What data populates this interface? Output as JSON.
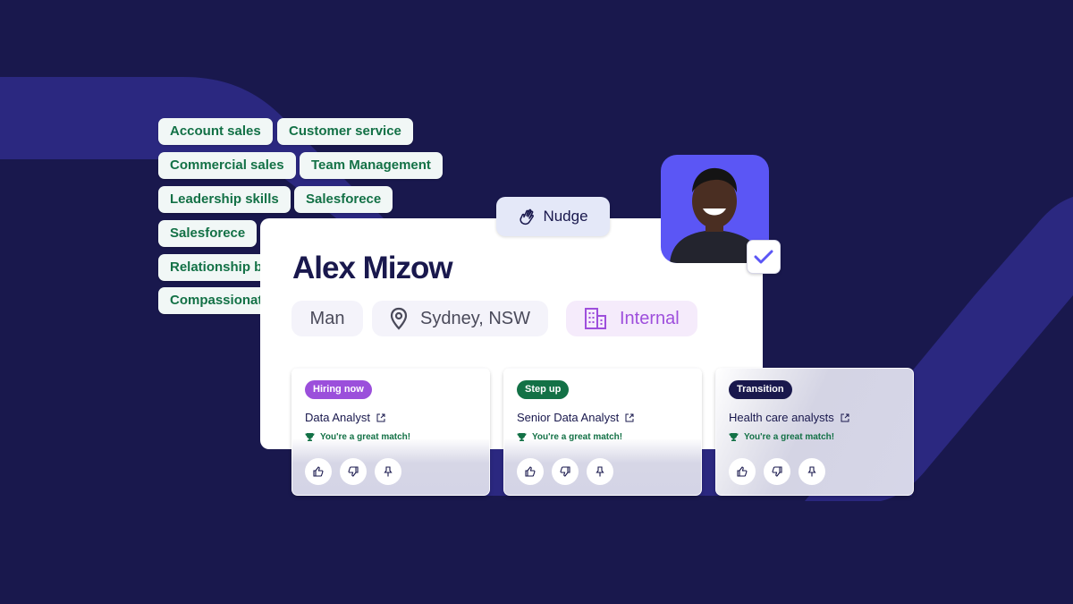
{
  "skills": [
    {
      "label": "Account sales"
    },
    {
      "label": "Customer service"
    },
    {
      "label": "Commercial sales"
    },
    {
      "label": "Team Management"
    },
    {
      "label": "Leadership skills"
    },
    {
      "label": "Salesforece"
    },
    {
      "label": "Salesforece"
    },
    {
      "label": "Relationship bu"
    },
    {
      "label": "Compassionat"
    }
  ],
  "profile": {
    "name": "Alex Mizow",
    "gender": "Man",
    "location": "Sydney, NSW",
    "employment_type": "Internal",
    "nudge_label": "Nudge",
    "avatar_icon": "person-photo",
    "verified_icon": "checkmark-icon"
  },
  "jobs": [
    {
      "badge": "Hiring now",
      "badge_color": "#9b4fdb",
      "title": "Data Analyst",
      "match": "You're a great match!"
    },
    {
      "badge": "Step up",
      "badge_color": "#137146",
      "title": "Senior Data Analyst",
      "match": "You're a great match!"
    },
    {
      "badge": "Transition",
      "badge_color": "#19184d",
      "title": "Health care analysts",
      "match": "You're a great match!"
    }
  ],
  "colors": {
    "background": "#19184d",
    "accent_band": "#2b2880",
    "brand_purple": "#5b56f5",
    "success_green": "#137146",
    "internal_purple": "#9e4fdc"
  }
}
